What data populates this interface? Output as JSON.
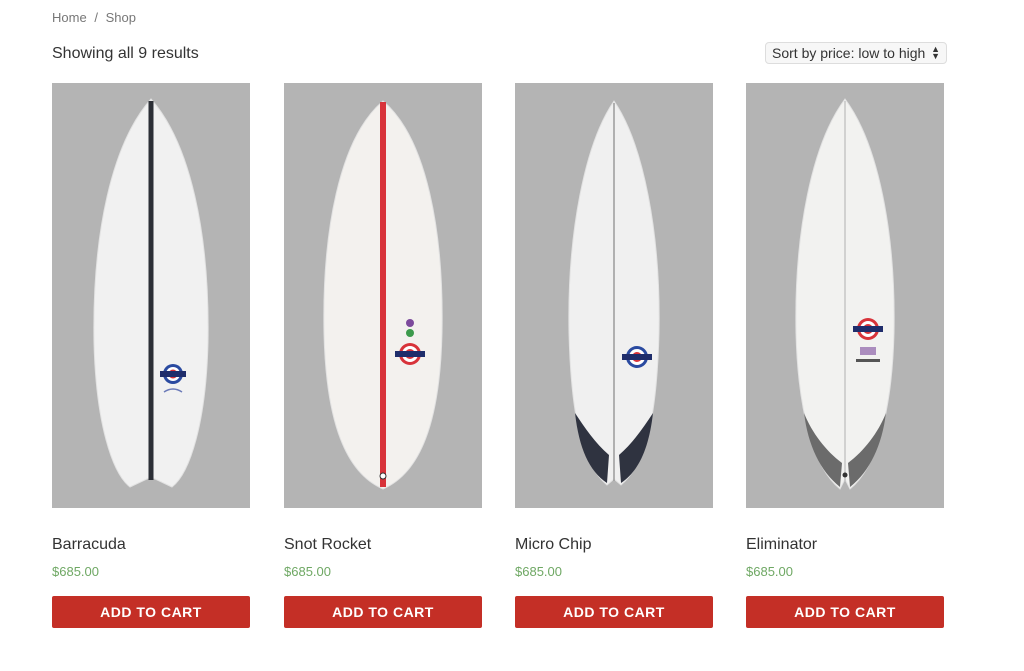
{
  "breadcrumb": {
    "home": "Home",
    "separator": "/",
    "current": "Shop"
  },
  "result_count": "Showing all 9 results",
  "sort": {
    "selected": "Sort by price: low to high"
  },
  "products": [
    {
      "name": "Barracuda",
      "price": "$685.00",
      "button": "ADD TO CART",
      "stringer_color": "#2c2f36"
    },
    {
      "name": "Snot Rocket",
      "price": "$685.00",
      "button": "ADD TO CART",
      "stringer_color": "#d8333a"
    },
    {
      "name": "Micro Chip",
      "price": "$685.00",
      "button": "ADD TO CART",
      "stringer_color": "#9a9a9a"
    },
    {
      "name": "Eliminator",
      "price": "$685.00",
      "button": "ADD TO CART",
      "stringer_color": "#b0b0b0"
    }
  ],
  "colors": {
    "accent": "#c42f26",
    "price": "#6fa864",
    "image_bg": "#b4b4b4"
  }
}
